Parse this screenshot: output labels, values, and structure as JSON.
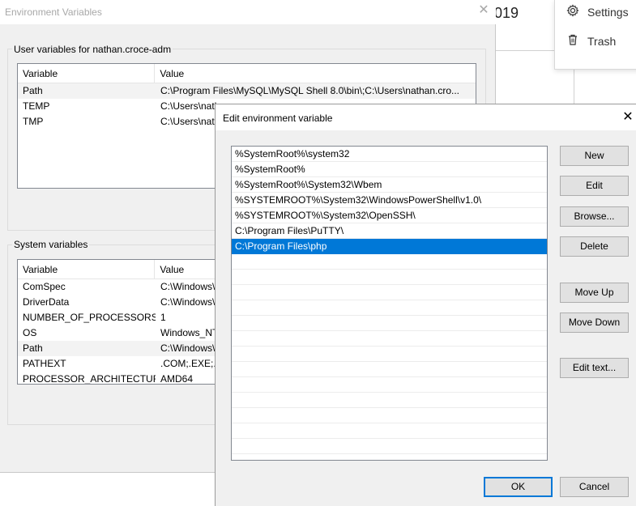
{
  "background_app": {
    "year_fragment": "019",
    "menu": [
      {
        "label": "Settings",
        "icon": "gear-icon"
      },
      {
        "label": "Trash",
        "icon": "trash-icon"
      }
    ]
  },
  "env_window": {
    "title": "Environment Variables",
    "user_group_label": "User variables for nathan.croce-adm",
    "user_columns": [
      "Variable",
      "Value"
    ],
    "user_rows": [
      {
        "variable": "Path",
        "value": "C:\\Program Files\\MySQL\\MySQL Shell 8.0\\bin\\;C:\\Users\\nathan.cro...",
        "selected": true
      },
      {
        "variable": "TEMP",
        "value": "C:\\Users\\nath",
        "selected": false
      },
      {
        "variable": "TMP",
        "value": "C:\\Users\\nath",
        "selected": false
      }
    ],
    "system_group_label": "System variables",
    "system_columns": [
      "Variable",
      "Value"
    ],
    "system_rows": [
      {
        "variable": "ComSpec",
        "value": "C:\\Windows\\",
        "selected": false
      },
      {
        "variable": "DriverData",
        "value": "C:\\Windows\\",
        "selected": false
      },
      {
        "variable": "NUMBER_OF_PROCESSORS",
        "value": "1",
        "selected": false
      },
      {
        "variable": "OS",
        "value": "Windows_NT",
        "selected": false
      },
      {
        "variable": "Path",
        "value": "C:\\Windows\\",
        "selected": true
      },
      {
        "variable": "PATHEXT",
        "value": ".COM;.EXE;.B",
        "selected": false
      },
      {
        "variable": "PROCESSOR_ARCHITECTURE",
        "value": "AMD64",
        "selected": false
      }
    ]
  },
  "edit_dialog": {
    "title": "Edit environment variable",
    "paths": [
      "%SystemRoot%\\system32",
      "%SystemRoot%",
      "%SystemRoot%\\System32\\Wbem",
      "%SYSTEMROOT%\\System32\\WindowsPowerShell\\v1.0\\",
      "%SYSTEMROOT%\\System32\\OpenSSH\\",
      "C:\\Program Files\\PuTTY\\",
      "C:\\Program Files\\php"
    ],
    "selected_index": 6,
    "buttons": {
      "new": "New",
      "edit": "Edit",
      "browse": "Browse...",
      "delete": "Delete",
      "move_up": "Move Up",
      "move_down": "Move Down",
      "edit_text": "Edit text...",
      "ok": "OK",
      "cancel": "Cancel"
    }
  },
  "colors": {
    "selection": "#0078d7",
    "window_bg": "#f0f0f0"
  }
}
